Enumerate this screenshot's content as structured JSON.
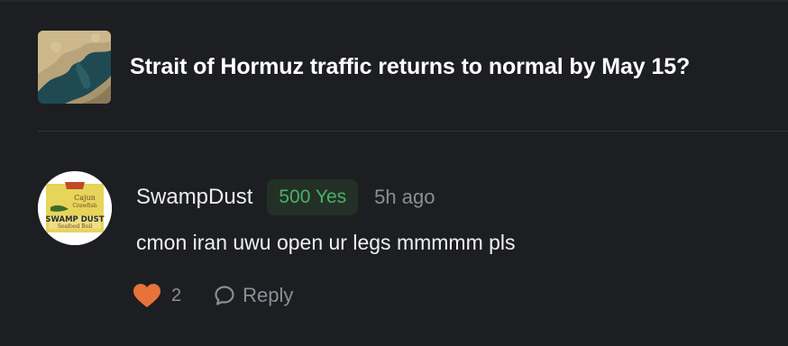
{
  "market": {
    "title": "Strait of Hormuz traffic returns to normal by May 15?",
    "thumbnail_icon": "strait-of-hormuz-satellite-map"
  },
  "comment": {
    "username": "SwampDust",
    "position_badge": "500 Yes",
    "timestamp": "5h ago",
    "text": "cmon iran uwu open ur legs mmmmm pls",
    "avatar_icon": "swamp-dust-seafood-boil-logo",
    "avatar_logo_text": [
      "Cajun",
      "Crawfish",
      "SWAMP DUST",
      "Seafood Boil"
    ],
    "likes": "2",
    "reply_label": "Reply"
  },
  "colors": {
    "background": "#1d1e22",
    "divider": "#33343a",
    "badge_bg": "#233025",
    "badge_text": "#4caf6a",
    "heart": "#e8733a",
    "muted_text": "#8d8e94"
  }
}
